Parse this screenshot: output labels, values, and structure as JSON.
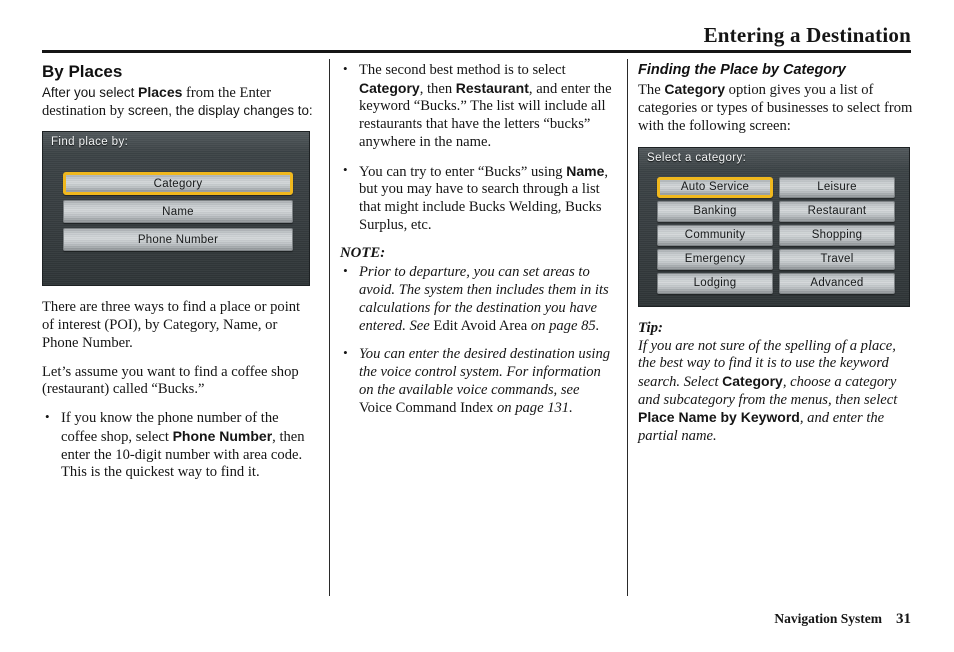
{
  "header": {
    "title": "Entering a Destination"
  },
  "footer": {
    "book_title": "Navigation System",
    "page_number": "31"
  },
  "columns": {
    "left": {
      "heading": "By Places",
      "intro": {
        "part1": "After you select ",
        "bold1": "Places",
        "part2": " from the Enter destination by",
        "part3": " screen, the display changes to:"
      },
      "nav_screen": {
        "title": "Find place by:",
        "buttons": [
          {
            "label": "Category",
            "selected": true
          },
          {
            "label": "Name",
            "selected": false
          },
          {
            "label": "Phone Number",
            "selected": false
          }
        ]
      },
      "para_ways": "There are three ways to find a place or point of interest (POI), by Category, Name, or Phone Number.",
      "para_assume": "Let’s assume you want to find a coffee shop (restaurant) called “Bucks.”",
      "bullet_phone": {
        "part1": "If you know the phone number of the coffee shop, select ",
        "bold1": "Phone Number",
        "part2": ", then enter the 10-digit number with area code. This is the quickest way to find it."
      }
    },
    "middle": {
      "bullet_category": {
        "part1": "The second best method is to select ",
        "bold1": "Category",
        "part2": ", then ",
        "bold2": "Restaurant",
        "part3": ", and enter the keyword “Bucks.” The list will include all restaurants that have the letters “bucks” anywhere in the name."
      },
      "bullet_name": {
        "part1": "You can try to enter “Bucks” using ",
        "bold1": "Name",
        "part2": ", but you may have to search through a list that might include Bucks Welding, Bucks Surplus, etc."
      },
      "note_heading": "NOTE:",
      "note_bullets": [
        {
          "part1": "Prior to departure, you can set areas to avoid. The system then includes them in its calculations for the destination you have entered. See ",
          "roman1": "Edit Avoid Area",
          "part2": " on page 85."
        },
        {
          "part1": "You can enter the desired destination using the voice control system. For information on the available voice commands, see ",
          "roman1": "Voice Command Index",
          "part2": " on page 131."
        }
      ]
    },
    "right": {
      "heading": "Finding the Place by Category",
      "intro": {
        "part1": "The ",
        "bold1": "Category",
        "part2": " option gives you a list of categories or types of businesses to select from with the following screen:"
      },
      "nav_screen": {
        "title": "Select a category:",
        "buttons": [
          {
            "label": "Auto Service",
            "selected": true
          },
          {
            "label": "Leisure",
            "selected": false
          },
          {
            "label": "Banking",
            "selected": false
          },
          {
            "label": "Restaurant",
            "selected": false
          },
          {
            "label": "Community",
            "selected": false
          },
          {
            "label": "Shopping",
            "selected": false
          },
          {
            "label": "Emergency",
            "selected": false
          },
          {
            "label": "Travel",
            "selected": false
          },
          {
            "label": "Lodging",
            "selected": false
          },
          {
            "label": "Advanced",
            "selected": false
          }
        ]
      },
      "tip_heading": "Tip:",
      "tip_body": {
        "part1": "If you are not sure of the spelling of a place, the best way to find it is to use the keyword search. Select ",
        "bold1": "Category",
        "part2": ", choose a category and subcategory from the menus, then select ",
        "bold2": "Place Name by Keyword",
        "part3": ", and enter the partial name."
      }
    }
  },
  "colors": {
    "accent_selected": "#f0b81e",
    "screen_background": "#373d40",
    "button_face": "#c3c8cb",
    "text": "#151515"
  }
}
